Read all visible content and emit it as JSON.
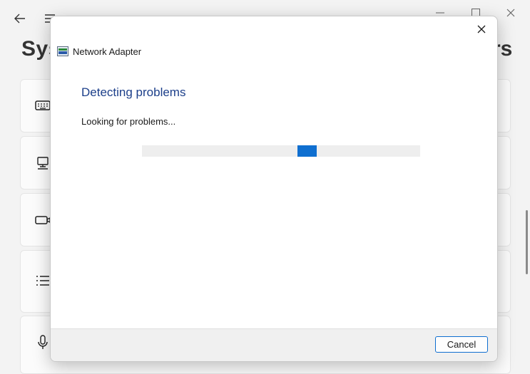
{
  "background_window": {
    "title_left": "Sys",
    "title_right": "rs",
    "icons": [
      "back-arrow-icon",
      "hamburger-menu-icon",
      "keyboard-icon",
      "computer-icon",
      "camera-icon",
      "list-icon",
      "microphone-icon"
    ]
  },
  "dialog": {
    "app_title": "Network Adapter",
    "heading": "Detecting problems",
    "status": "Looking for problems...",
    "progress": {
      "track_color": "#eeeeee",
      "chunk_color": "#0f6fd0",
      "indeterminate": true,
      "chunk_start": 0.56,
      "chunk_end": 0.63
    },
    "cancel_label": "Cancel",
    "close_glyph": "✕"
  },
  "colors": {
    "accent": "#0f6fd0",
    "heading": "#1c3f8a"
  }
}
